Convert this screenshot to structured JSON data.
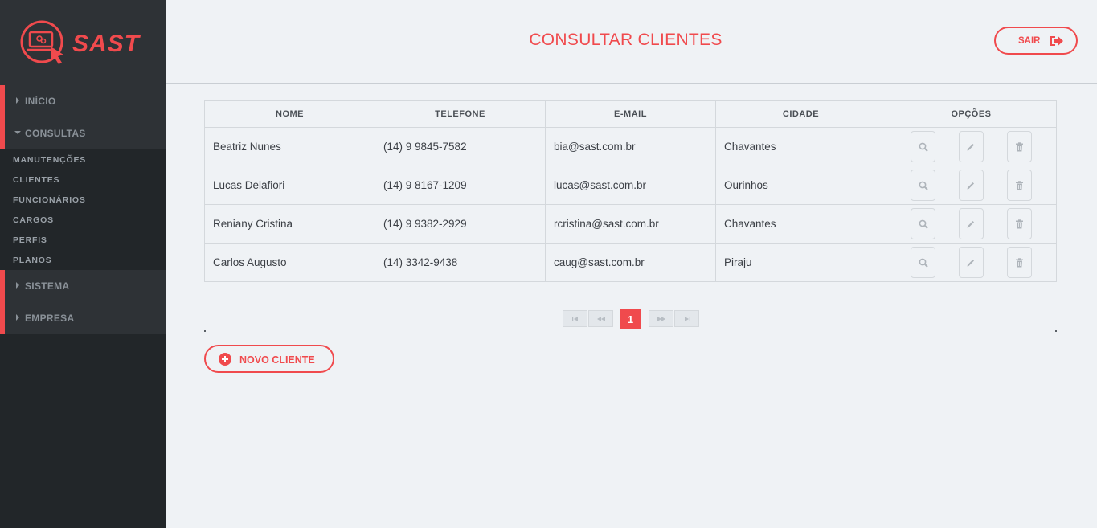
{
  "brand": {
    "name": "SAST"
  },
  "sidebar": {
    "groups": [
      {
        "label": "INÍCIO",
        "expanded": false
      },
      {
        "label": "CONSULTAS",
        "expanded": true
      },
      {
        "label": "SISTEMA",
        "expanded": false
      },
      {
        "label": "EMPRESA",
        "expanded": false
      }
    ],
    "subitems": [
      "MANUTENÇÕES",
      "CLIENTES",
      "FUNCIONÁRIOS",
      "CARGOS",
      "PERFIS",
      "PLANOS"
    ]
  },
  "header": {
    "title": "CONSULTAR CLIENTES",
    "logout_label": "SAIR"
  },
  "table": {
    "columns": [
      "NOME",
      "TELEFONE",
      "E-MAIL",
      "CIDADE",
      "OPÇÕES"
    ],
    "rows": [
      {
        "nome": "Beatriz Nunes",
        "telefone": "(14) 9 9845-7582",
        "email": "bia@sast.com.br",
        "cidade": "Chavantes"
      },
      {
        "nome": "Lucas Delafiori",
        "telefone": "(14) 9 8167-1209",
        "email": "lucas@sast.com.br",
        "cidade": "Ourinhos"
      },
      {
        "nome": "Reniany Cristina",
        "telefone": "(14) 9 9382-2929",
        "email": "rcristina@sast.com.br",
        "cidade": "Chavantes"
      },
      {
        "nome": "Carlos Augusto",
        "telefone": "(14) 3342-9438",
        "email": "caug@sast.com.br",
        "cidade": "Piraju"
      }
    ]
  },
  "pagination": {
    "current_page": "1"
  },
  "actions": {
    "new_label": "NOVO CLIENTE"
  },
  "colors": {
    "accent": "#f04a4d",
    "sidebar_bg": "#222629",
    "content_bg": "#eff2f5"
  }
}
